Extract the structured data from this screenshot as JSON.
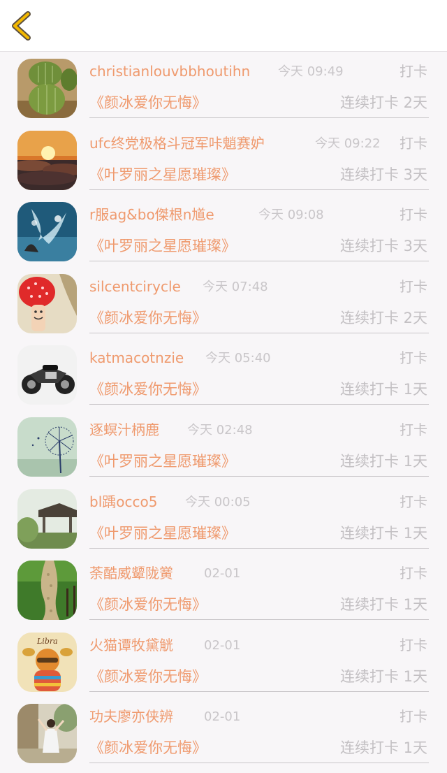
{
  "nav": {
    "back_icon": "chevron-left-icon",
    "accent": "#f3b800"
  },
  "colors": {
    "name": "#ef9a6e",
    "muted": "#c3c0c3",
    "background": "#f8f6f8"
  },
  "items": [
    {
      "name": "christianlouvbbhoutihn",
      "time": "今天 09:49",
      "action": "打卡",
      "book": "《颜冰爱你无悔》",
      "streak": "连续打卡 2天",
      "avatar": "cactus"
    },
    {
      "name": "ufc终党极格斗冠军咔魈赛妒",
      "time": "今天 09:22",
      "action": "打卡",
      "book": "《叶罗丽之星愿璀璨》",
      "streak": "连续打卡 3天",
      "avatar": "sunset"
    },
    {
      "name": "r服ag&bo傑根n馗e",
      "time": "今天 09:08",
      "action": "打卡",
      "book": "《叶罗丽之星愿璀璨》",
      "streak": "连续打卡 3天",
      "avatar": "water-splash"
    },
    {
      "name": "silcentcirycle",
      "time": "今天 07:48",
      "action": "打卡",
      "book": "《颜冰爱你无悔》",
      "streak": "连续打卡 2天",
      "avatar": "strawberry"
    },
    {
      "name": "katmacotnzie",
      "time": "今天 05:40",
      "action": "打卡",
      "book": "《颜冰爱你无悔》",
      "streak": "连续打卡 1天",
      "avatar": "motorcycle"
    },
    {
      "name": "逐螟汁柄鹿",
      "time": "今天 02:48",
      "action": "打卡",
      "book": "《叶罗丽之星愿璀璨》",
      "streak": "连续打卡 1天",
      "avatar": "dandelion"
    },
    {
      "name": "bl踽occo5",
      "time": "今天 00:05",
      "action": "打卡",
      "book": "《叶罗丽之星愿璀璨》",
      "streak": "连续打卡 1天",
      "avatar": "pavilion"
    },
    {
      "name": "荼酷威颦陇黉",
      "time": "02-01",
      "action": "打卡",
      "book": "《颜冰爱你无悔》",
      "streak": "连续打卡 1天",
      "avatar": "garden-path"
    },
    {
      "name": "火猫谭牧黛觥",
      "time": "02-01",
      "action": "打卡",
      "book": "《颜冰爱你无悔》",
      "streak": "连续打卡 1天",
      "avatar": "libra-cartoon",
      "avatar_text": "Libra"
    },
    {
      "name": "功夫廖亦侠辨",
      "time": "02-01",
      "action": "打卡",
      "book": "《颜冰爱你无悔》",
      "streak": "连续打卡 1天",
      "avatar": "girl-in-garden"
    }
  ]
}
